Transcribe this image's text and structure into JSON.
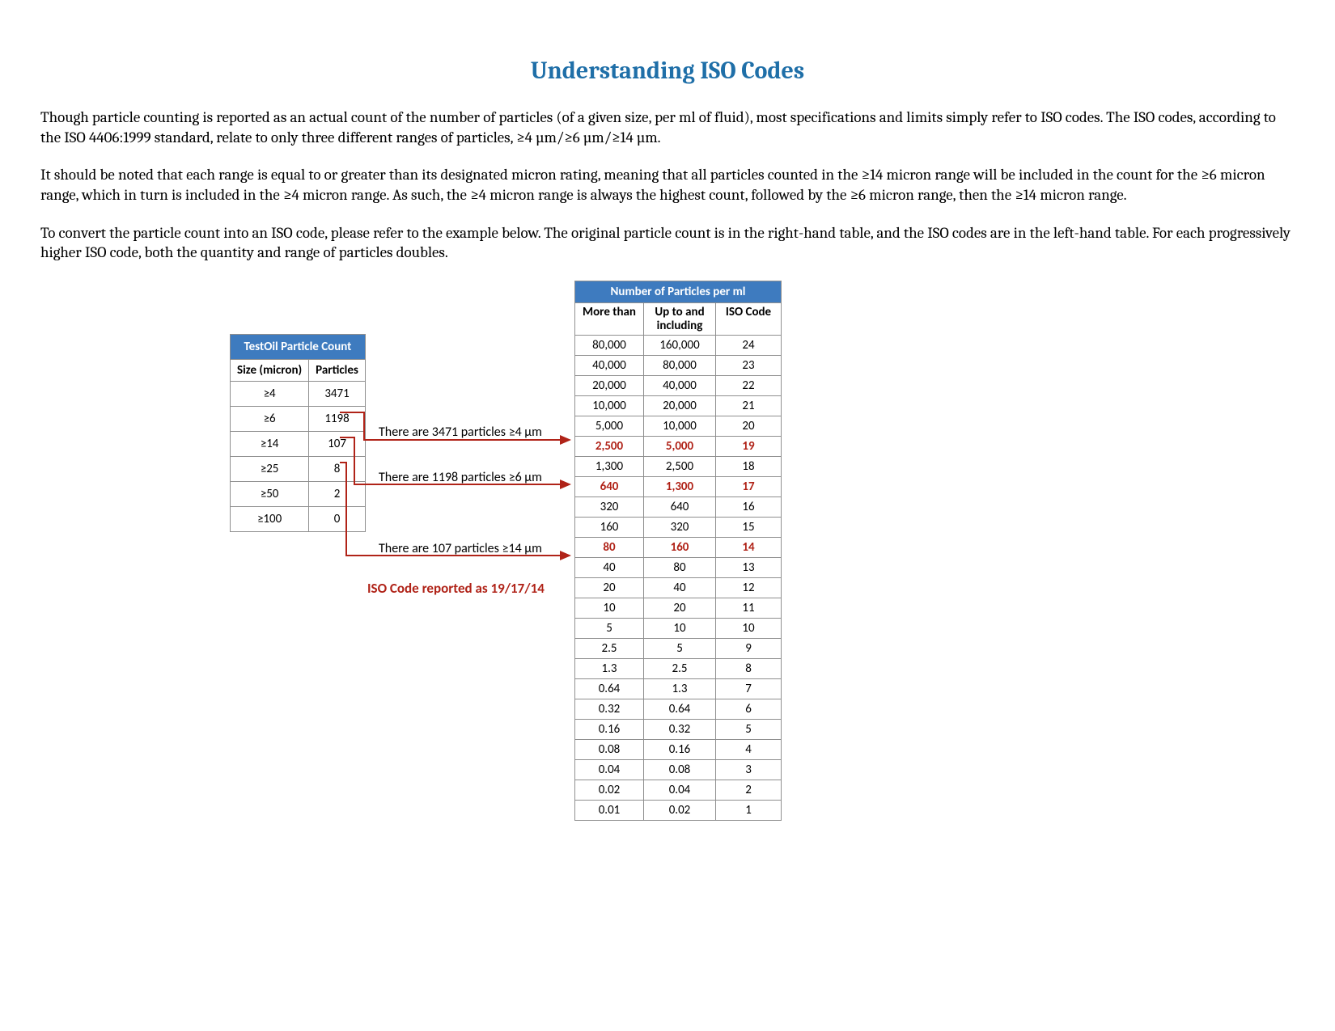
{
  "title": "Understanding ISO Codes",
  "paragraphs": {
    "p1": "Though particle counting is reported as an actual count of the number of particles (of a given size, per ml of fluid), most specifications and limits simply refer to ISO codes. The ISO codes, according to the ISO 4406:1999 standard, relate to only three different ranges of particles, ≥4 µm/≥6 µm/≥14 µm.",
    "p2": "It should be noted that each range is equal to or greater than its designated micron rating, meaning that all particles counted in the ≥14 micron range will be included in the count for the ≥6 micron range, which in turn is included in the ≥4 micron range. As such, the ≥4 micron range is always the highest count, followed by the ≥6 micron range, then the ≥14 micron range.",
    "p3": "To convert the particle count into an ISO code, please refer to the example below. The original particle count is in the right-hand table, and the ISO codes are in the left-hand table. For each progressively higher ISO code, both the quantity and range of particles doubles."
  },
  "left_table": {
    "title": "TestOil Particle Count",
    "col_size": "Size (micron)",
    "col_particles": "Particles",
    "rows": [
      {
        "size": "≥4",
        "particles": "3471"
      },
      {
        "size": "≥6",
        "particles": "1198"
      },
      {
        "size": "≥14",
        "particles": "107"
      },
      {
        "size": "≥25",
        "particles": "8"
      },
      {
        "size": "≥50",
        "particles": "2"
      },
      {
        "size": "≥100",
        "particles": "0"
      }
    ]
  },
  "annotations": {
    "a4": "There are 3471 particles ≥4 µm",
    "a6": "There are 1198 particles ≥6 µm",
    "a14": "There are 107 particles ≥14 µm",
    "reported": "ISO Code reported as 19/17/14"
  },
  "right_table": {
    "title": "Number of Particles per ml",
    "col_more": "More than",
    "col_upto": "Up to and including",
    "col_iso": "ISO Code",
    "rows": [
      {
        "more": "80,000",
        "upto": "160,000",
        "iso": "24",
        "hl": false
      },
      {
        "more": "40,000",
        "upto": "80,000",
        "iso": "23",
        "hl": false
      },
      {
        "more": "20,000",
        "upto": "40,000",
        "iso": "22",
        "hl": false
      },
      {
        "more": "10,000",
        "upto": "20,000",
        "iso": "21",
        "hl": false
      },
      {
        "more": "5,000",
        "upto": "10,000",
        "iso": "20",
        "hl": false
      },
      {
        "more": "2,500",
        "upto": "5,000",
        "iso": "19",
        "hl": true
      },
      {
        "more": "1,300",
        "upto": "2,500",
        "iso": "18",
        "hl": false
      },
      {
        "more": "640",
        "upto": "1,300",
        "iso": "17",
        "hl": true
      },
      {
        "more": "320",
        "upto": "640",
        "iso": "16",
        "hl": false
      },
      {
        "more": "160",
        "upto": "320",
        "iso": "15",
        "hl": false
      },
      {
        "more": "80",
        "upto": "160",
        "iso": "14",
        "hl": true
      },
      {
        "more": "40",
        "upto": "80",
        "iso": "13",
        "hl": false
      },
      {
        "more": "20",
        "upto": "40",
        "iso": "12",
        "hl": false
      },
      {
        "more": "10",
        "upto": "20",
        "iso": "11",
        "hl": false
      },
      {
        "more": "5",
        "upto": "10",
        "iso": "10",
        "hl": false
      },
      {
        "more": "2.5",
        "upto": "5",
        "iso": "9",
        "hl": false
      },
      {
        "more": "1.3",
        "upto": "2.5",
        "iso": "8",
        "hl": false
      },
      {
        "more": "0.64",
        "upto": "1.3",
        "iso": "7",
        "hl": false
      },
      {
        "more": "0.32",
        "upto": "0.64",
        "iso": "6",
        "hl": false
      },
      {
        "more": "0.16",
        "upto": "0.32",
        "iso": "5",
        "hl": false
      },
      {
        "more": "0.08",
        "upto": "0.16",
        "iso": "4",
        "hl": false
      },
      {
        "more": "0.04",
        "upto": "0.08",
        "iso": "3",
        "hl": false
      },
      {
        "more": "0.02",
        "upto": "0.04",
        "iso": "2",
        "hl": false
      },
      {
        "more": "0.01",
        "upto": "0.02",
        "iso": "1",
        "hl": false
      }
    ]
  }
}
